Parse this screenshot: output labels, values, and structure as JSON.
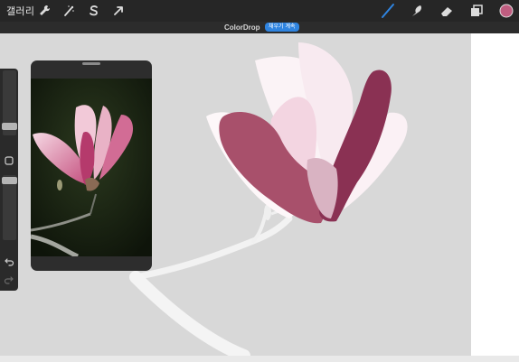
{
  "toolbar": {
    "gallery_label": "갤러리",
    "left_tools": [
      "wrench-icon",
      "magic-wand-icon",
      "selection-s-icon",
      "transform-arrow-icon"
    ],
    "right_tools": [
      "brush-icon",
      "smudge-icon",
      "eraser-icon",
      "layers-icon",
      "color-swatch"
    ],
    "active_tool": "brush",
    "active_color": "#c05d80",
    "active_tool_color": "#2f84e0"
  },
  "titlebar": {
    "title": "ColorDrop",
    "badge": "채우기 계속"
  },
  "sidebar": {
    "size_slider": 0.83,
    "opacity_slider": 0.0,
    "modify_button": "square-icon",
    "undo": "undo-icon",
    "redo": "redo-icon"
  },
  "reference": {
    "subject": "magnolia-photo"
  },
  "canvas": {
    "background": "#d8d8d8",
    "stroke_color": "#a8506b",
    "stroke_dark_color": "#8a3153"
  }
}
